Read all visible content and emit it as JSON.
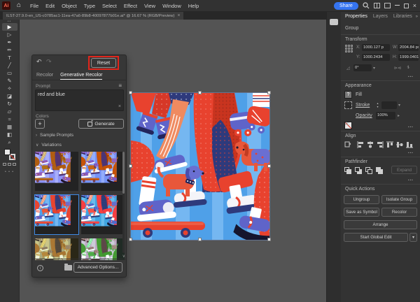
{
  "app": {
    "name": "Adobe Illustrator",
    "share_label": "Share"
  },
  "menubar": {
    "items": [
      "File",
      "Edit",
      "Object",
      "Type",
      "Select",
      "Effect",
      "View",
      "Window",
      "Help"
    ]
  },
  "document_tab": {
    "title": "ILST-27.9.0-en_US-c0785ac1-11ea-47a6-89b8-40097877b01e.ai* @ 16.67 % (RGB/Preview)",
    "close_glyph": "×"
  },
  "toolbar": {
    "tools": [
      {
        "name": "selection-tool",
        "glyph": "▶"
      },
      {
        "name": "direct-selection-tool",
        "glyph": "▷"
      },
      {
        "name": "pen-tool",
        "glyph": "✒"
      },
      {
        "name": "curvature-tool",
        "glyph": "✏"
      },
      {
        "name": "type-tool",
        "glyph": "T"
      },
      {
        "name": "line-segment-tool",
        "glyph": "╱"
      },
      {
        "name": "rectangle-tool",
        "glyph": "▭"
      },
      {
        "name": "paintbrush-tool",
        "glyph": "✎"
      },
      {
        "name": "shaper-tool",
        "glyph": "✧"
      },
      {
        "name": "eraser-tool",
        "glyph": "◪"
      },
      {
        "name": "rotate-tool",
        "glyph": "↻"
      },
      {
        "name": "scale-tool",
        "glyph": "▱"
      },
      {
        "name": "width-tool",
        "glyph": "≈"
      },
      {
        "name": "mesh-tool",
        "glyph": "▦"
      },
      {
        "name": "gradient-tool",
        "glyph": "◧"
      },
      {
        "name": "zoom-tool",
        "glyph": "⌕"
      }
    ],
    "more_glyph": "• • •"
  },
  "recolor_dialog": {
    "undo_glyph": "↶",
    "redo_glyph": "↷",
    "reset_label": "Reset",
    "tab_recolor": "Recolor",
    "tab_generative": "Generative Recolor",
    "prompt_label": "Prompt",
    "prompt_value": "red and blue",
    "clear_glyph": "×",
    "menu_glyph": "≡",
    "colors_label": "Colors",
    "add_label": "+",
    "generate_label": "Generate",
    "sample_prompts_label": "Sample Prompts",
    "sample_prompts_chevron": "›",
    "variations_label": "Variations",
    "variations_chevron": "∨",
    "advanced_label": "Advanced Options...",
    "info_glyph": "i",
    "scroll_down_glyph": "∨",
    "variations": [
      {
        "name": "variation-1",
        "selected": false
      },
      {
        "name": "variation-2",
        "selected": false
      },
      {
        "name": "variation-3",
        "selected": true
      },
      {
        "name": "variation-4",
        "selected": false
      },
      {
        "name": "variation-5",
        "selected": false
      },
      {
        "name": "variation-6",
        "selected": false
      }
    ]
  },
  "properties": {
    "tabs": [
      "Properties",
      "Layers",
      "Libraries"
    ],
    "collapse_glyph": "»",
    "selection_type": "Group",
    "transform": {
      "title": "Transform",
      "x_label": "X:",
      "x_value": "1000.127 p",
      "w_label": "W:",
      "w_value": "2004.84 px",
      "y_label": "Y:",
      "y_value": "1000.2434",
      "h_label": "H:",
      "h_value": "1999.0401",
      "angle_value": "0°",
      "more_glyph": "•••"
    },
    "appearance": {
      "title": "Appearance",
      "fill_label": "Fill",
      "fill_swatch_glyph": "?",
      "stroke_label": "Stroke",
      "opacity_label": "Opacity",
      "opacity_value": "100%",
      "fx_label": "fx.",
      "more_glyph": "•••"
    },
    "align": {
      "title": "Align",
      "more_glyph": "•••"
    },
    "pathfinder": {
      "title": "Pathfinder",
      "expand_label": "Expand",
      "more_glyph": "•••"
    },
    "quick_actions": {
      "title": "Quick Actions",
      "ungroup": "Ungroup",
      "isolate": "Isolate Group",
      "save_symbol": "Save as Symbol",
      "recolor": "Recolor",
      "arrange": "Arrange",
      "global_edit": "Start Global Edit",
      "global_edit_chevron": "▾"
    }
  },
  "colors": {
    "accent_selection_blue": "#3E8AE6",
    "share_blue": "#3574F0",
    "annotation_red": "#E1251B",
    "canvas_gray": "#545454",
    "panel_gray": "#333333",
    "artwork": {
      "background_blue": "#4FA0E8",
      "stripe_light_blue": "#7EBDF2",
      "red": "#E8422E",
      "coral": "#E8573A",
      "salmon": "#EF8A60",
      "navy": "#2E3A7C",
      "periwinkle": "#5F64C9",
      "white": "#FFFFFF",
      "dark_sole": "#15152E"
    }
  }
}
